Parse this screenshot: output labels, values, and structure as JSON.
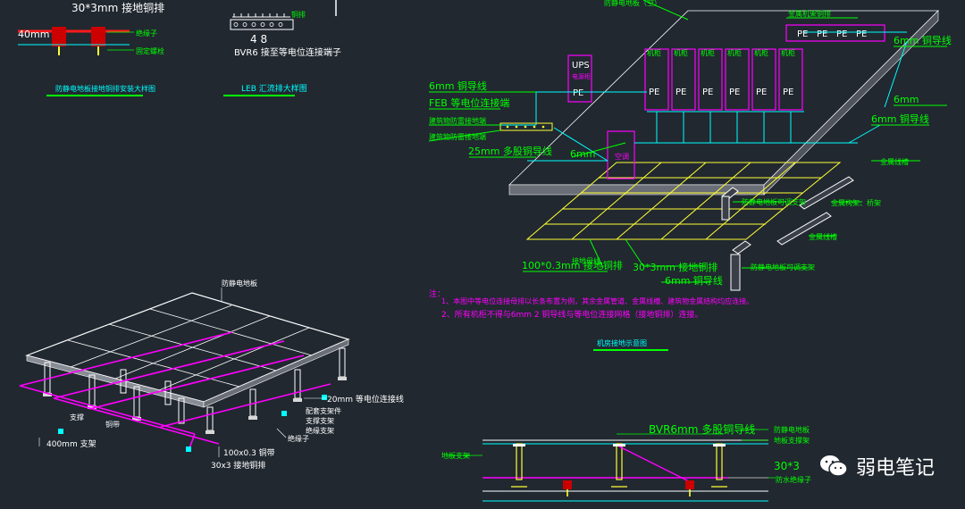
{
  "colors": {
    "background": "#212830",
    "green": "#00ff00",
    "cyan": "#00ffff",
    "magenta": "#ff00ff",
    "yellow": "#ffff33",
    "red": "#ff1a1a",
    "white": "#ffffff",
    "gray_slab": "#888c94"
  },
  "detail_top_left": {
    "dim_top": "30*3mm 接地铜排",
    "dim_left": "40mm",
    "label_1": "绝缘子",
    "label_2": "固定螺栓",
    "caption": "防静电地板接地铜排安装大样图"
  },
  "detail_leb": {
    "top_label": "铜排",
    "numbers": "4 8",
    "bottom_label": "BVR6 接至等电位连接端子",
    "caption": "LEB 汇流排大样图"
  },
  "floor_detail": {
    "label_floor": "防静电地板",
    "label_20mm": "20mm 等电位连接线",
    "label_insulator": "绝缘子",
    "label_support": "支撑",
    "label_copper": "铜带",
    "label_100": "100x0.3 铜带",
    "label_30x3": "30x3 接地铜排",
    "label_400": "400mm 支架",
    "label_bracket_1": "配套支架件",
    "label_bracket_2": "支撑支架",
    "label_bracket_3": "绝缘支架"
  },
  "room_diagram": {
    "ups_label": "UPS",
    "ups_sub": "电源柜",
    "pe": "PE",
    "cabinet_label": "机柜",
    "label_6mm_1": "6mm 铜导线",
    "label_feb": "FEB 等电位连接端",
    "label_lightning_1": "建筑物防雷接地端",
    "label_lightning_2": "建筑物防雷接地端",
    "label_25mm": "25mm 多股铜导线",
    "label_6mm_mid": "6mm",
    "label_aircon": "空调",
    "label_6mm_right_top": "6mm 铜导线",
    "label_6mm_right_mid": "6mm",
    "label_6mm_right_low": "6mm 铜导线",
    "label_metal_1": "金属线槽",
    "label_metal_2": "金属构架、桥架",
    "label_metal_3": "金属线槽",
    "label_pipe_1": "防静电地板可调支架",
    "label_pipe_2": "防静电地板可调支架",
    "label_pipe_3": "接地母线",
    "label_100": "100*0.3mm 接地铜排",
    "label_30x3": "30*3mm 接地铜排",
    "label_6mm_bottom": "6mm 铜导线",
    "label_top": "防静电地板（空）",
    "label_top_right": "金属机架铜排",
    "note_title": "注：",
    "note_1": "1、本图中等电位连接母排以长条布置为例，其余金属管道、金属线槽、建筑物金属结构均应连接。",
    "note_2": "2、所有机柜不得与6mm 2 铜导线与等电位连接网格（接地铜排）连接。",
    "caption": "机房接地示意图"
  },
  "section_detail": {
    "label_bvr": "BVR6mm 多股铜导线",
    "label_floor": "防静电地板",
    "label_support": "地板支撑架",
    "label_30": "30*3",
    "label_insulator": "防水绝缘子",
    "label_left": "地板支架"
  },
  "watermark": {
    "text": "弱电笔记",
    "icon": "wechat-icon"
  }
}
